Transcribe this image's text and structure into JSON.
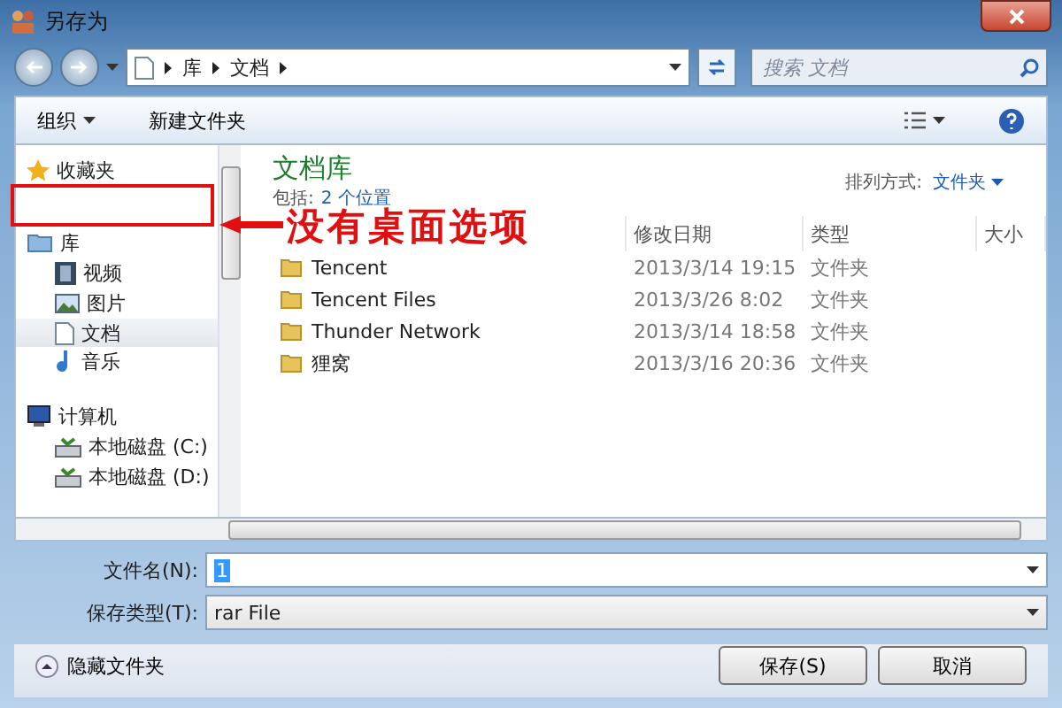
{
  "window": {
    "title": "另存为"
  },
  "address": {
    "crumbs": [
      "库",
      "文档"
    ]
  },
  "search": {
    "placeholder": "搜索 文档"
  },
  "toolbar": {
    "organize": "组织",
    "new_folder": "新建文件夹"
  },
  "sidebar": {
    "groups": [
      {
        "label": "收藏夹",
        "kind": "star"
      },
      {
        "label": "库",
        "kind": "library",
        "children": [
          {
            "label": "视频",
            "kind": "video",
            "selected": false
          },
          {
            "label": "图片",
            "kind": "picture",
            "selected": false
          },
          {
            "label": "文档",
            "kind": "document",
            "selected": true
          },
          {
            "label": "音乐",
            "kind": "music",
            "selected": false
          }
        ]
      },
      {
        "label": "计算机",
        "kind": "computer",
        "children": [
          {
            "label": "本地磁盘 (C:)",
            "kind": "drive",
            "selected": false
          },
          {
            "label": "本地磁盘 (D:)",
            "kind": "drive",
            "selected": false
          }
        ]
      }
    ]
  },
  "library": {
    "title": "文档库",
    "includes_label": "包括:",
    "includes_link": "2 个位置",
    "sort_label": "排列方式:",
    "sort_value": "文件夹"
  },
  "table": {
    "columns": [
      "修改日期",
      "类型",
      "大小"
    ],
    "rows": [
      {
        "name": "Tencent",
        "modified": "2013/3/14 19:15",
        "type": "文件夹"
      },
      {
        "name": "Tencent Files",
        "modified": "2013/3/26 8:02",
        "type": "文件夹"
      },
      {
        "name": "Thunder Network",
        "modified": "2013/3/14 18:58",
        "type": "文件夹"
      },
      {
        "name": "狸窝",
        "modified": "2013/3/16 20:36",
        "type": "文件夹"
      }
    ]
  },
  "filename": {
    "label": "文件名(N):",
    "value": "1"
  },
  "filetype": {
    "label": "保存类型(T):",
    "value": "rar File"
  },
  "hide_folders": "隐藏文件夹",
  "buttons": [
    "保存(S)",
    "取消"
  ],
  "annotation": {
    "text": "没有桌面选项"
  }
}
